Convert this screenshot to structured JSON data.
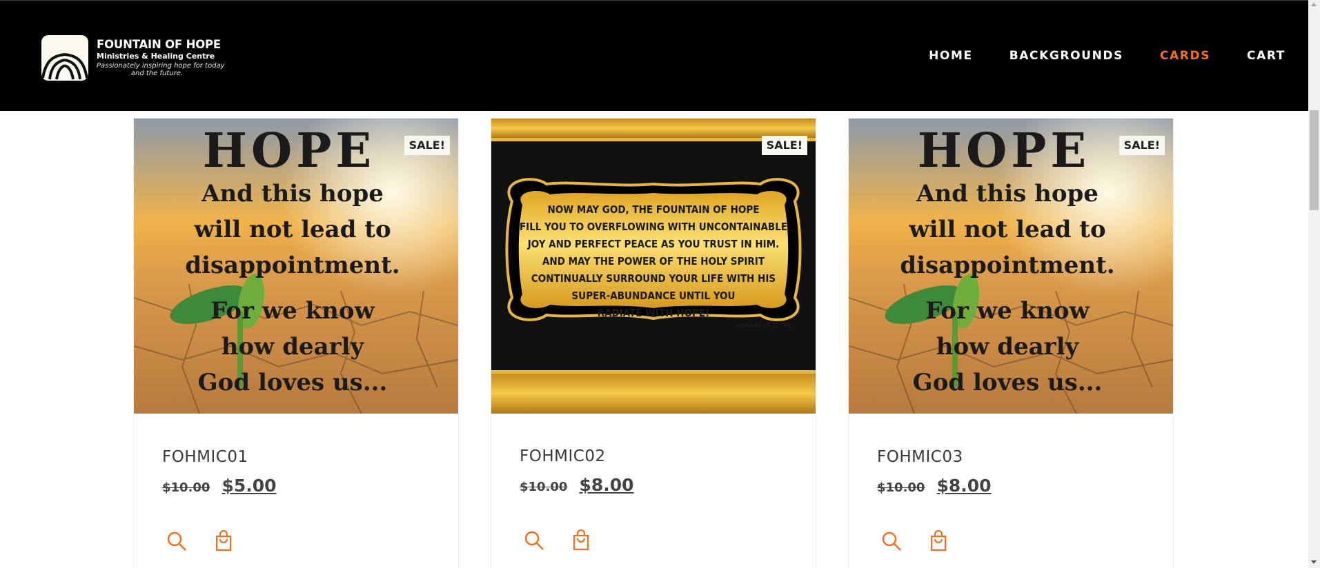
{
  "brand": {
    "title": "FOUNTAIN OF HOPE",
    "subtitle": "Ministries & Healing Centre",
    "tagline_1": "Passionately inspiring hope for today",
    "tagline_2": "and the future.",
    "logo_icon": "fountain-arcs-logo"
  },
  "nav": {
    "items": [
      "HOME",
      "BACKGROUNDS",
      "CARDS",
      "CART"
    ],
    "active": "CARDS",
    "accent_color": "#f26f1f"
  },
  "products": [
    {
      "sale_label": "SALE!",
      "name": "FOHMIC01",
      "old_price": "$10.00",
      "price": "$5.00",
      "image_text": [
        "HOPE",
        "And this hope",
        "will not lead to",
        "disappointment.",
        "For we know",
        "how dearly",
        "God loves us..."
      ]
    },
    {
      "sale_label": "SALE!",
      "name": "FOHMIC02",
      "old_price": "$10.00",
      "price": "$8.00",
      "image_text": [
        "NOW MAY GOD, THE FOUNTAIN OF HOPE",
        "FILL YOU TO OVERFLOWING WITH UNCONTAINABLE",
        "JOY AND PERFECT PEACE AS YOU TRUST IN HIM.",
        "AND MAY THE POWER OF THE HOLY SPIRIT",
        "CONTINUALLY SURROUND YOUR LIFE WITH HIS",
        "SUPER-ABUNDANCE UNTIL YOU",
        "RADIATE WITH HOPE!",
        "ROMANS 15:13 TPT"
      ]
    },
    {
      "sale_label": "SALE!",
      "name": "FOHMIC03",
      "old_price": "$10.00",
      "price": "$8.00",
      "image_text": [
        "HOPE",
        "And this hope",
        "will not lead to",
        "disappointment.",
        "For we know",
        "how dearly",
        "God loves us..."
      ]
    }
  ],
  "actions": {
    "quick_view_icon": "search-icon",
    "add_to_cart_icon": "shopping-bag-icon",
    "icon_color": "#f26f1f"
  }
}
